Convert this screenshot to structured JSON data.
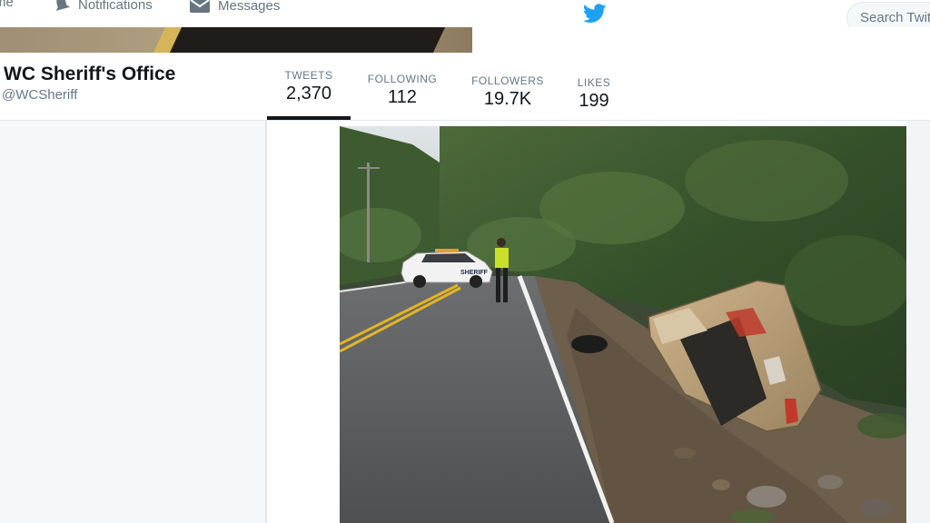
{
  "nav": {
    "home_label": "me",
    "notifications_label": "Notifications",
    "messages_label": "Messages",
    "search_placeholder": "Search Twit"
  },
  "profile": {
    "name": "WC Sheriff's Office",
    "handle": "@WCSheriff"
  },
  "stats": [
    {
      "label": "TWEETS",
      "value": "2,370"
    },
    {
      "label": "FOLLOWING",
      "value": "112"
    },
    {
      "label": "FOLLOWERS",
      "value": "19.7K"
    },
    {
      "label": "LIKES",
      "value": "199"
    }
  ],
  "photo": {
    "sheriff_car_text": "SHERIFF"
  },
  "colors": {
    "twitter_blue": "#1da1f2",
    "banner_gold": "#d6b45a",
    "banner_dark": "#1f1c1a"
  }
}
